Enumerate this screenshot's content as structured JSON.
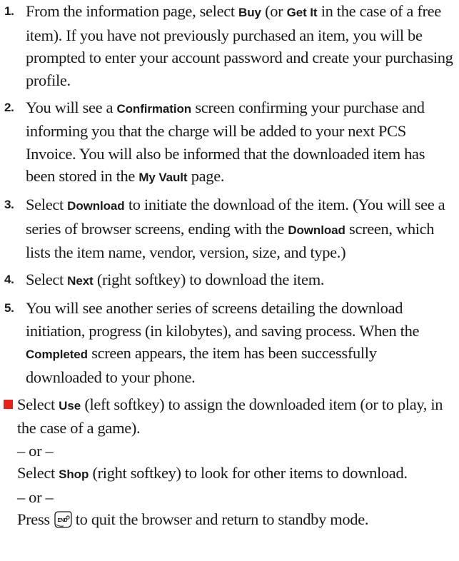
{
  "steps": [
    {
      "number": "1.",
      "parts": [
        "From the information page, select ",
        "Buy",
        " (or ",
        "Get It",
        " in the case of a free item). If you have not previously purchased an item, you will be prompted to enter your account password and create your purchasing profile."
      ]
    },
    {
      "number": "2.",
      "parts": [
        "You will see a ",
        "Confirmation",
        " screen confirming your purchase and informing you that the charge will be added to your next PCS Invoice. You will also be informed that the downloaded item has been stored in the ",
        "My Vault",
        " page."
      ]
    },
    {
      "number": "3.",
      "parts": [
        "Select ",
        "Download",
        " to initiate the download of the item. (You will see a series of browser screens, ending with the ",
        "Download",
        " screen, which lists the item name, vendor, version, size, and type.)"
      ]
    },
    {
      "number": "4.",
      "parts": [
        "Select ",
        "Next",
        " (right softkey) to download the item."
      ]
    },
    {
      "number": "5.",
      "parts": [
        "You will see another series of screens detailing the download initiation, progress (in kilobytes), and saving process. When the ",
        "Completed",
        " screen appears, the item has been successfully downloaded to your phone."
      ]
    }
  ],
  "bullet": {
    "use_line": [
      "Select ",
      "Use",
      " (left softkey) to assign the downloaded item (or to play, in the case of a game)."
    ],
    "or_1": "– or –",
    "shop_line": [
      "Select ",
      "Shop",
      " (right softkey) to look for other items to download."
    ],
    "or_2": "– or –",
    "press_before": "Press",
    "press_after": "to quit the browser and return to standby mode.",
    "end_key_label": "END",
    "bullet_color": "#e8221b",
    "end_key_icon": "end-key-icon"
  }
}
